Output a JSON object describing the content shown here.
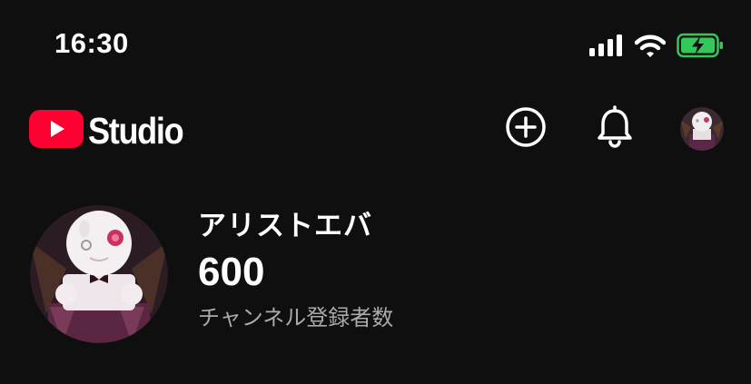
{
  "status_bar": {
    "time": "16:30",
    "icons": [
      "cellular-signal-icon",
      "wifi-icon",
      "battery-charging-icon"
    ]
  },
  "header": {
    "logo_text": "Studio",
    "icons": [
      "youtube-play-icon",
      "create-plus-icon",
      "notification-bell-icon",
      "account-avatar"
    ]
  },
  "channel": {
    "name": "アリストエバ",
    "subscriber_count": "600",
    "subscriber_label": "チャンネル登録者数"
  },
  "colors": {
    "background": "#0f0f0f",
    "youtube_red": "#ff0033",
    "battery_green": "#34c759",
    "secondary_text": "#aaaaaa"
  }
}
